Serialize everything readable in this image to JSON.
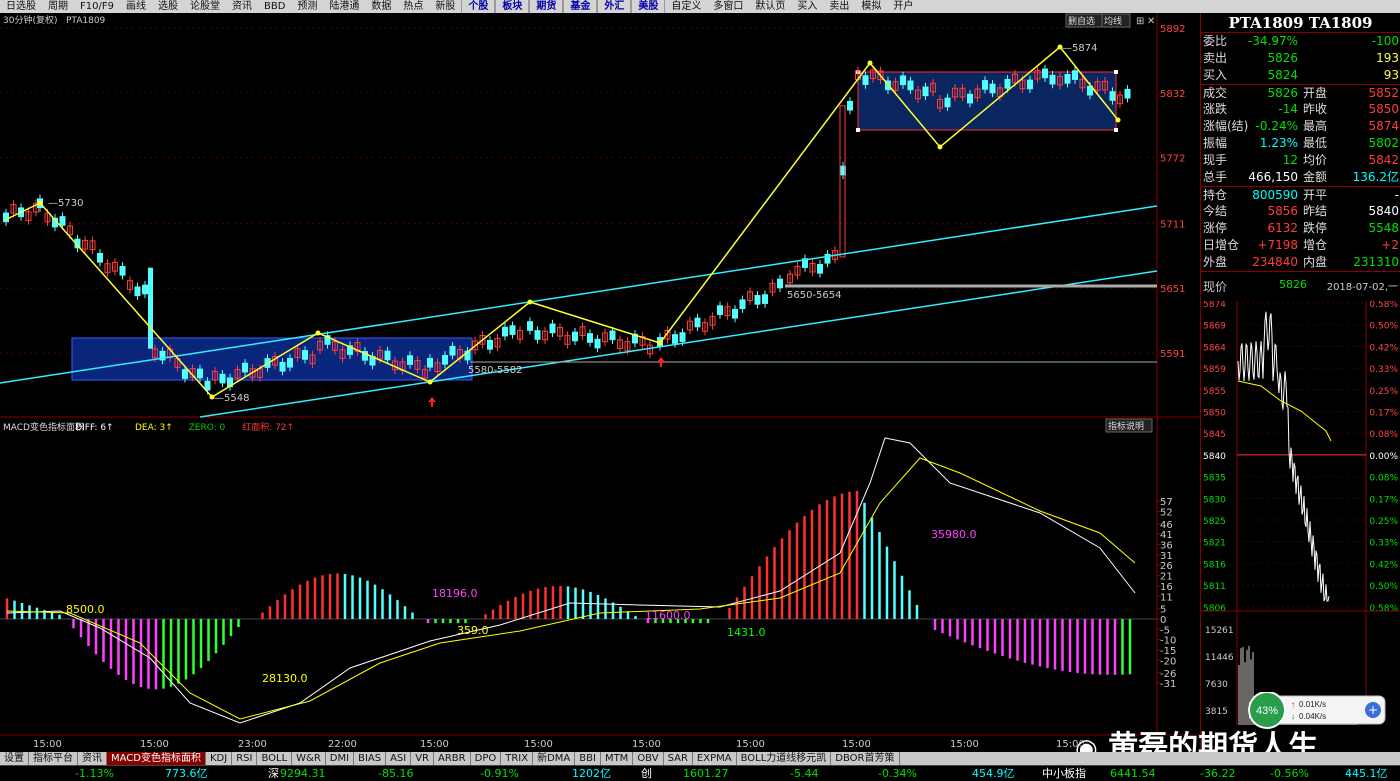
{
  "menu": [
    "日选股",
    "周期",
    "F10/F9",
    "画线",
    "选股",
    "论股堂",
    "资讯",
    "BBD",
    "预测",
    "陆港通",
    "数据",
    "热点",
    "新股",
    "个股",
    "板块",
    "期货",
    "基金",
    "外汇",
    "美股",
    "自定义",
    "多窗口",
    "默认页",
    "买入",
    "卖出",
    "模拟",
    "开户"
  ],
  "chart_header": {
    "period": "30分钟(复权)",
    "symbol": "PTA1809",
    "btn_delete": "删自选",
    "btn_ma": "均线"
  },
  "price_axis": [
    "5892",
    "5832",
    "5772",
    "5711",
    "5651",
    "5591"
  ],
  "price_annotations": {
    "high_left": "5730",
    "low": "5548",
    "high_right": "5874",
    "zone_low": "5580-5582",
    "zone_mid": "5650-5654"
  },
  "macd_header": {
    "name": "MACD变色指标面积",
    "diff_label": "DIFF:",
    "diff_value": "6",
    "dea_label": "DEA:",
    "dea_value": "3",
    "zero_label": "ZERO:",
    "zero_value": "0",
    "red_area_label": "红面积:",
    "red_area_value": "72",
    "help": "指标说明"
  },
  "macd_axis": [
    "57",
    "52",
    "46",
    "41",
    "36",
    "31",
    "26",
    "21",
    "16",
    "11",
    "5",
    "0",
    "-5",
    "-10",
    "-15",
    "-20",
    "-26",
    "-31"
  ],
  "macd_annotations": [
    "8500.0",
    "18196.0",
    "359.0",
    "11600.0",
    "1431.0",
    "28130.0",
    "35980.0"
  ],
  "time_axis": [
    "15:00",
    "15:00",
    "23:00",
    "22:00",
    "15:00",
    "15:00",
    "15:00",
    "15:00",
    "15:00",
    "15:00",
    "15:00"
  ],
  "quote": {
    "title": "PTA1809 TA1809",
    "rows": [
      {
        "l": "委比",
        "v": "-34.97%",
        "vc": "grn",
        "l2": "",
        "v2": "-100",
        "v2c": "grn"
      },
      {
        "l": "卖出",
        "v": "5826",
        "vc": "grn",
        "l2": "",
        "v2": "193",
        "v2c": "yel"
      },
      {
        "l": "买入",
        "v": "5824",
        "vc": "grn",
        "l2": "",
        "v2": "93",
        "v2c": "yel"
      },
      {
        "l": "成交",
        "v": "5826",
        "vc": "grn",
        "l2": "开盘",
        "v2": "5852",
        "v2c": "red"
      },
      {
        "l": "涨跌",
        "v": "-14",
        "vc": "grn",
        "l2": "昨收",
        "v2": "5850",
        "v2c": "red"
      },
      {
        "l": "涨幅(结)",
        "v": "-0.24%",
        "vc": "grn",
        "l2": "最高",
        "v2": "5874",
        "v2c": "red"
      },
      {
        "l": "振幅",
        "v": "1.23%",
        "vc": "cyn",
        "l2": "最低",
        "v2": "5802",
        "v2c": "grn"
      },
      {
        "l": "现手",
        "v": "12",
        "vc": "grn",
        "l2": "均价",
        "v2": "5842",
        "v2c": "red"
      },
      {
        "l": "总手",
        "v": "466,150",
        "vc": "wht",
        "l2": "金额",
        "v2": "136.2亿",
        "v2c": "cyn"
      },
      {
        "l": "持仓",
        "v": "800590",
        "vc": "cyn",
        "l2": "开平",
        "v2": "-",
        "v2c": "wht"
      },
      {
        "l": "今结",
        "v": "5856",
        "vc": "red",
        "l2": "昨结",
        "v2": "5840",
        "v2c": "wht"
      },
      {
        "l": "涨停",
        "v": "6132",
        "vc": "red",
        "l2": "跌停",
        "v2": "5548",
        "v2c": "grn"
      },
      {
        "l": "日增仓",
        "v": "+7198",
        "vc": "red",
        "l2": "增仓",
        "v2": "+2",
        "v2c": "red"
      },
      {
        "l": "外盘",
        "v": "234840",
        "vc": "red",
        "l2": "内盘",
        "v2": "231310",
        "v2c": "grn"
      }
    ],
    "current_label": "现价",
    "current_value": "5826",
    "date": "2018-07-02,一"
  },
  "mini_chart": {
    "prices": [
      "5874",
      "5869",
      "5864",
      "5859",
      "5855",
      "5850",
      "5845",
      "5840",
      "5835",
      "5830",
      "5825",
      "5821",
      "5816",
      "5811",
      "5806"
    ],
    "pcts": [
      "0.58%",
      "0.50%",
      "0.42%",
      "0.33%",
      "0.25%",
      "0.17%",
      "0.08%",
      "0.00%",
      "0.08%",
      "0.17%",
      "0.25%",
      "0.33%",
      "0.42%",
      "0.50%",
      "0.58%"
    ],
    "vols": [
      "15261",
      "11446",
      "7630",
      "3815"
    ]
  },
  "speed": {
    "percent": "43%",
    "up": "0.01K/s",
    "down": "0.04K/s"
  },
  "tabs": [
    "设置",
    "指标平台",
    "资讯",
    "MACD变色指标面积",
    "KDJ",
    "RSI",
    "BOLL",
    "W&R",
    "DMI",
    "BIAS",
    "ASI",
    "VR",
    "ARBR",
    "DPO",
    "TRIX",
    "新DMA",
    "BBI",
    "MTM",
    "OBV",
    "SAR",
    "EXPMA",
    "BOLL力道线移元凯",
    "DBOR首芳策"
  ],
  "status": [
    {
      "t": "-1.13%",
      "c": "grn"
    },
    {
      "t": "773.6亿",
      "c": "cyn"
    },
    {
      "t": "深",
      "c": "wht"
    },
    {
      "t": "9294.31",
      "c": "grn"
    },
    {
      "t": "-85.16",
      "c": "grn"
    },
    {
      "t": "-0.91%",
      "c": "grn"
    },
    {
      "t": "1202亿",
      "c": "cyn"
    },
    {
      "t": "创",
      "c": "wht"
    },
    {
      "t": "1601.27",
      "c": "grn"
    },
    {
      "t": "-5.44",
      "c": "grn"
    },
    {
      "t": "-0.34%",
      "c": "grn"
    },
    {
      "t": "454.9亿",
      "c": "cyn"
    },
    {
      "t": "中小板指",
      "c": "wht"
    },
    {
      "t": "6441.54",
      "c": "grn"
    },
    {
      "t": "-36.22",
      "c": "grn"
    },
    {
      "t": "-0.56%",
      "c": "grn"
    },
    {
      "t": "445.1亿",
      "c": "cyn"
    }
  ],
  "watermark": "黄磊的期货人生"
}
